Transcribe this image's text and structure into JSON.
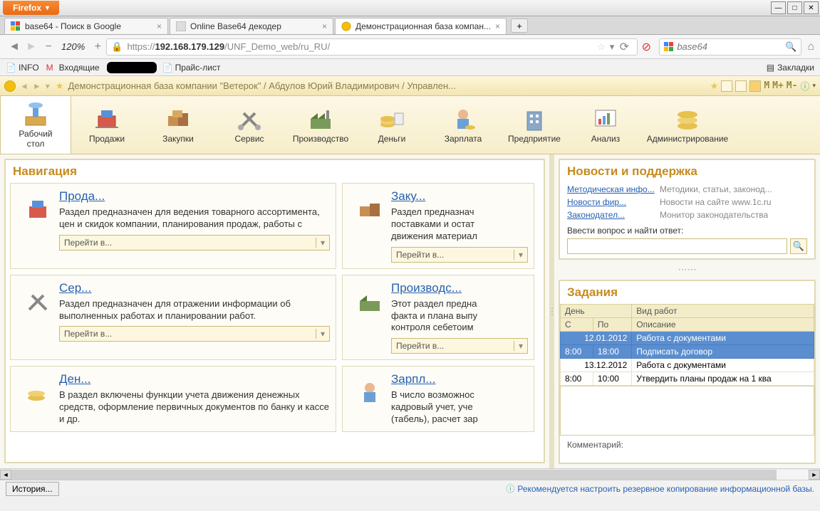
{
  "firefox_label": "Firefox",
  "tabs": [
    {
      "label": "base64 - Поиск в Google"
    },
    {
      "label": "Online Base64 декодер"
    },
    {
      "label": "Демонстрационная база компан..."
    }
  ],
  "url": {
    "zoom": "120%",
    "proto": "https://",
    "host": "192.168.179.129",
    "path": "/UNF_Demo_web/ru_RU/"
  },
  "search_placeholder": "base64",
  "bookmarks": {
    "info": "INFO",
    "inbox": "Входящие",
    "price": "Прайс-лист",
    "zakl": "Закладки"
  },
  "onec_title": "Демонстрационная база компании \"Ветерок\" / Абдулов Юрий Владимирович / Управлен...",
  "msize": [
    "M",
    "M+",
    "M-"
  ],
  "sections": [
    {
      "label": "Рабочий\nстол"
    },
    {
      "label": "Продажи"
    },
    {
      "label": "Закупки"
    },
    {
      "label": "Сервис"
    },
    {
      "label": "Производство"
    },
    {
      "label": "Деньги"
    },
    {
      "label": "Зарплата"
    },
    {
      "label": "Предприятие"
    },
    {
      "label": "Анализ"
    },
    {
      "label": "Администрирование"
    }
  ],
  "nav_title": "Навигация",
  "goto_label": "Перейти в...",
  "cards": [
    {
      "link": "Прода...",
      "desc": "Раздел предназначен для ведения товарного ассортимента, цен и скидок компании, планирования продаж, работы с"
    },
    {
      "link": "Заку...",
      "desc": "Раздел предназнач\nпоставками и остат\nдвижения материал"
    },
    {
      "link": "Сер...",
      "desc": "Раздел предназначен для отражении информации об выполненных работах и планировании работ."
    },
    {
      "link": "Производс...",
      "desc": "Этот раздел предна\nфакта и плана выпу\nконтроля себетоим"
    },
    {
      "link": "Ден...",
      "desc": "В раздел включены функции учета движения денежных средств, оформление первичных документов по банку и кассе и др."
    },
    {
      "link": "Зарпл...",
      "desc": "В число возможнос\nкадровый учет, уче\n(табель), расчет зар"
    }
  ],
  "news": {
    "title": "Новости и поддержка",
    "rows": [
      {
        "link": "Методическая инфо...",
        "desc": "Методики, статьи, законод..."
      },
      {
        "link": "Новости фир...",
        "desc": "Новости на сайте www.1c.ru"
      },
      {
        "link": "Законодател...",
        "desc": "Монитор законодательства"
      }
    ],
    "search_label": "Ввести вопрос и найти ответ:"
  },
  "tasks": {
    "title": "Задания",
    "cols": {
      "day": "День",
      "type": "Вид работ",
      "from": "С",
      "to": "По",
      "desc": "Описание"
    },
    "rows": [
      {
        "date": "12.01.2012",
        "type": "Работа с документами",
        "from": "8:00",
        "to": "18:00",
        "desc": "Подписать договор",
        "sel": true
      },
      {
        "date": "13.12.2012",
        "type": "Работа с документами",
        "from": "8:00",
        "to": "10:00",
        "desc": "Утвердить планы продаж на 1 ква",
        "sel": false
      }
    ],
    "comment_label": "Комментарий:"
  },
  "history_btn": "История...",
  "status_msg": "Рекомендуется настроить резервное копирование информационной базы."
}
